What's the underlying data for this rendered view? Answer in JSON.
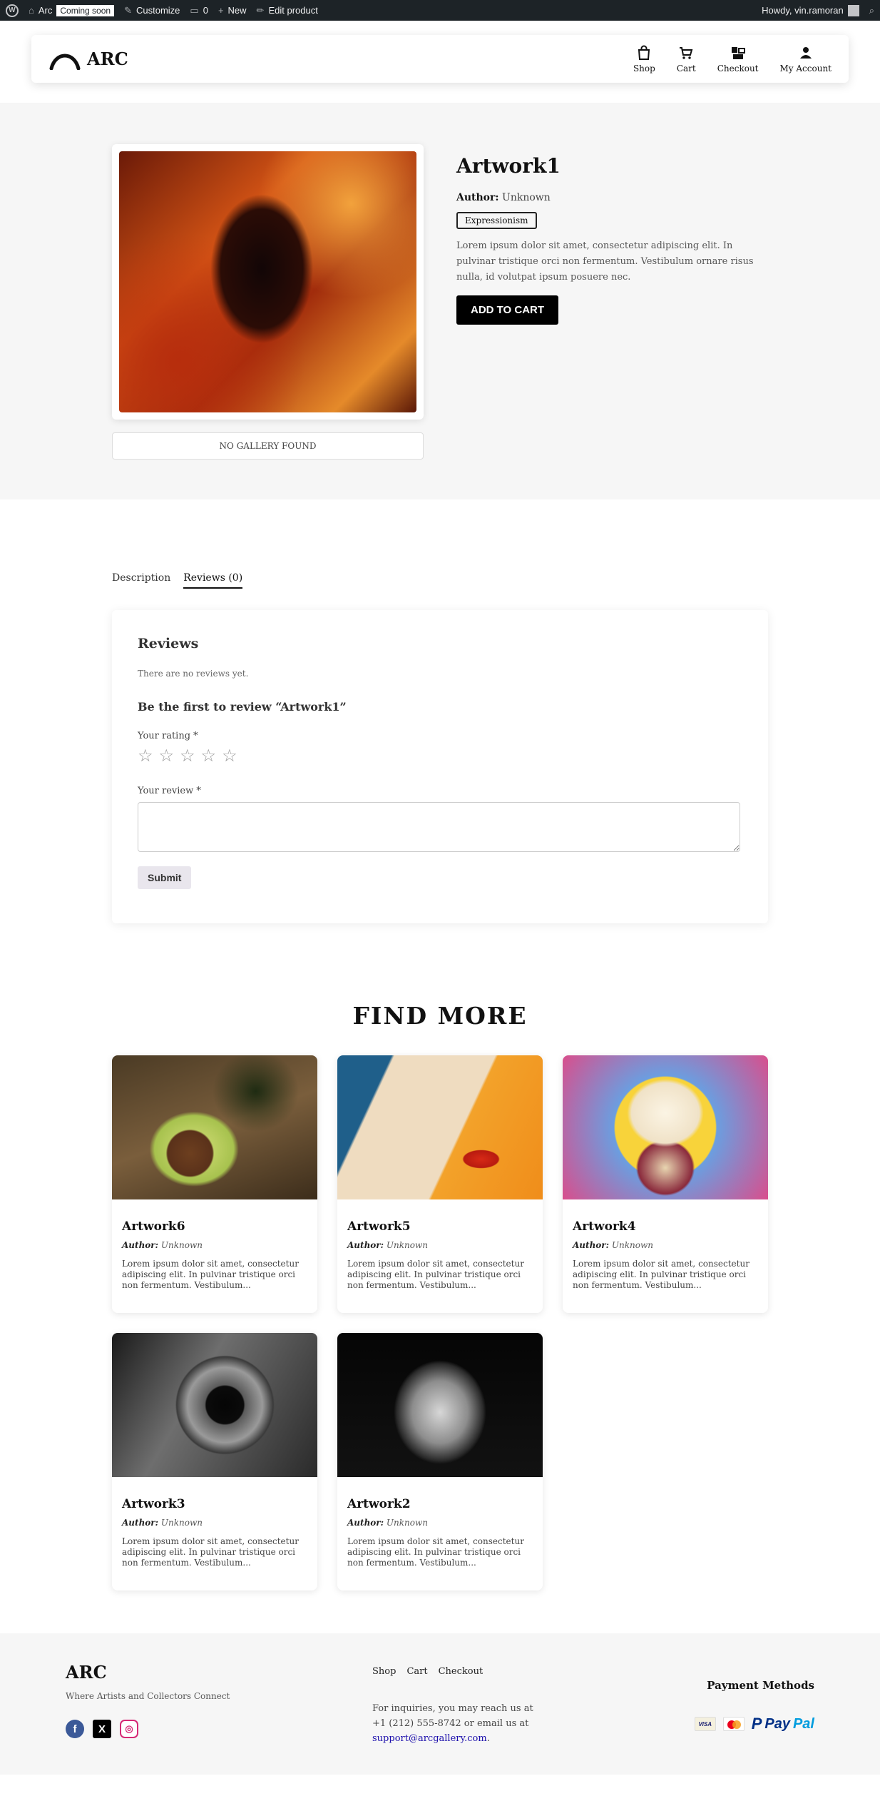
{
  "admin_bar": {
    "site_name": "Arc",
    "coming_soon": "Coming soon",
    "customize": "Customize",
    "comments_count": "0",
    "new": "New",
    "edit_product": "Edit product",
    "howdy": "Howdy, vin.ramoran"
  },
  "header": {
    "logo": "ARC",
    "nav": [
      {
        "label": "Shop",
        "icon": "shopping-bag-icon"
      },
      {
        "label": "Cart",
        "icon": "cart-icon"
      },
      {
        "label": "Checkout",
        "icon": "checkout-icon"
      },
      {
        "label": "My Account",
        "icon": "user-icon"
      }
    ]
  },
  "product": {
    "title": "Artwork1",
    "author_label": "Author:",
    "author": "Unknown",
    "genre": "Expressionism",
    "description": "Lorem ipsum dolor sit amet, consectetur adipiscing elit. In pulvinar tristique orci non fermentum. Vestibulum ornare risus nulla, id volutpat ipsum posuere nec.",
    "add_to_cart": "ADD TO CART",
    "no_gallery": "NO GALLERY FOUND"
  },
  "tabs": [
    {
      "label": "Description",
      "active": false
    },
    {
      "label": "Reviews (0)",
      "active": true
    }
  ],
  "reviews": {
    "title": "Reviews",
    "empty": "There are no reviews yet.",
    "first": "Be the first to review “Artwork1”",
    "rating_label": "Your rating *",
    "review_label": "Your review *",
    "submit": "Submit"
  },
  "find_more": {
    "title": "FIND MORE",
    "author_label": "Author:",
    "items": [
      {
        "title": "Artwork6",
        "author": "Unknown",
        "desc": "Lorem ipsum dolor sit amet, consectetur adipiscing elit. In pulvinar tristique orci non fermentum. Vestibulum..."
      },
      {
        "title": "Artwork5",
        "author": "Unknown",
        "desc": "Lorem ipsum dolor sit amet, consectetur adipiscing elit. In pulvinar tristique orci non fermentum. Vestibulum..."
      },
      {
        "title": "Artwork4",
        "author": "Unknown",
        "desc": "Lorem ipsum dolor sit amet, consectetur adipiscing elit. In pulvinar tristique orci non fermentum. Vestibulum..."
      },
      {
        "title": "Artwork3",
        "author": "Unknown",
        "desc": "Lorem ipsum dolor sit amet, consectetur adipiscing elit. In pulvinar tristique orci non fermentum. Vestibulum..."
      },
      {
        "title": "Artwork2",
        "author": "Unknown",
        "desc": "Lorem ipsum dolor sit amet, consectetur adipiscing elit. In pulvinar tristique orci non fermentum. Vestibulum..."
      }
    ]
  },
  "footer": {
    "logo": "ARC",
    "tagline": "Where Artists and Collectors Connect",
    "links": [
      "Shop",
      "Cart",
      "Checkout"
    ],
    "inquiry_line1": "For inquiries, you may reach us at",
    "inquiry_line2": "+1 (212) 555-8742 or email us at",
    "email": "support@arcgallery.com",
    "payment_title": "Payment Methods",
    "visa": "VISA",
    "paypal_pay": "Pay",
    "paypal_pal": "Pal"
  },
  "colors": {
    "admin_bar": "#1d2327",
    "band": "#f6f6f6",
    "button": "#000000",
    "link": "#1a0dab"
  }
}
